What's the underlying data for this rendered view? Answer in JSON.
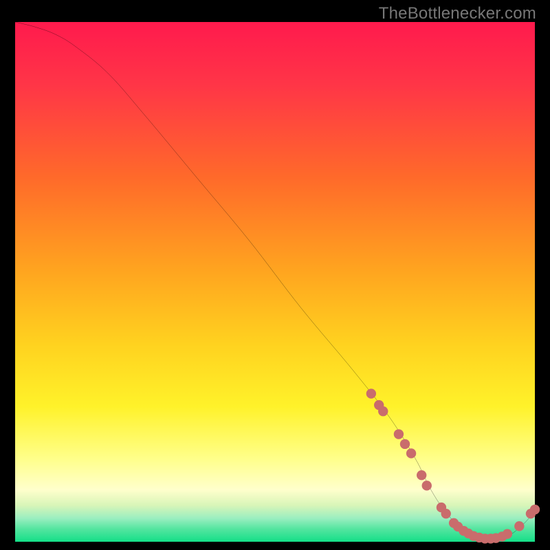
{
  "attribution": "TheBottlenecker.com",
  "colors": {
    "top": "#ff1a4d",
    "midTop": "#ff6a2a",
    "mid": "#ffd21f",
    "lightYellow": "#ffffbf",
    "teal": "#78e8a0",
    "green": "#15e189",
    "curve": "#000000",
    "point": "#c96c6c"
  },
  "chart_data": {
    "type": "line",
    "title": "",
    "xlabel": "",
    "ylabel": "",
    "xlim": [
      0,
      100
    ],
    "ylim": [
      0,
      100
    ],
    "series": [
      {
        "name": "curve",
        "x": [
          0,
          4,
          8,
          12,
          18,
          25,
          35,
          45,
          55,
          65,
          72,
          77,
          80,
          83,
          86,
          89,
          92,
          95,
          98,
          100
        ],
        "values": [
          100,
          99,
          97.5,
          95,
          90,
          82,
          70,
          58,
          45,
          33,
          24,
          16,
          10,
          5.5,
          2.6,
          1.0,
          0.5,
          1.2,
          3.6,
          6
        ]
      }
    ],
    "points": [
      {
        "x": 68.5,
        "y": 28.5
      },
      {
        "x": 70.0,
        "y": 26.3
      },
      {
        "x": 70.8,
        "y": 25.1
      },
      {
        "x": 73.8,
        "y": 20.7
      },
      {
        "x": 75.0,
        "y": 18.8
      },
      {
        "x": 76.2,
        "y": 17.0
      },
      {
        "x": 78.2,
        "y": 12.8
      },
      {
        "x": 79.2,
        "y": 10.8
      },
      {
        "x": 82.0,
        "y": 6.6
      },
      {
        "x": 82.9,
        "y": 5.4
      },
      {
        "x": 84.4,
        "y": 3.6
      },
      {
        "x": 85.2,
        "y": 2.9
      },
      {
        "x": 86.3,
        "y": 2.1
      },
      {
        "x": 87.2,
        "y": 1.6
      },
      {
        "x": 88.2,
        "y": 1.1
      },
      {
        "x": 89.3,
        "y": 0.8
      },
      {
        "x": 90.4,
        "y": 0.6
      },
      {
        "x": 91.5,
        "y": 0.6
      },
      {
        "x": 92.5,
        "y": 0.7
      },
      {
        "x": 93.7,
        "y": 1.0
      },
      {
        "x": 94.7,
        "y": 1.5
      },
      {
        "x": 97.0,
        "y": 3.0
      },
      {
        "x": 99.2,
        "y": 5.4
      },
      {
        "x": 100.0,
        "y": 6.2
      }
    ]
  }
}
